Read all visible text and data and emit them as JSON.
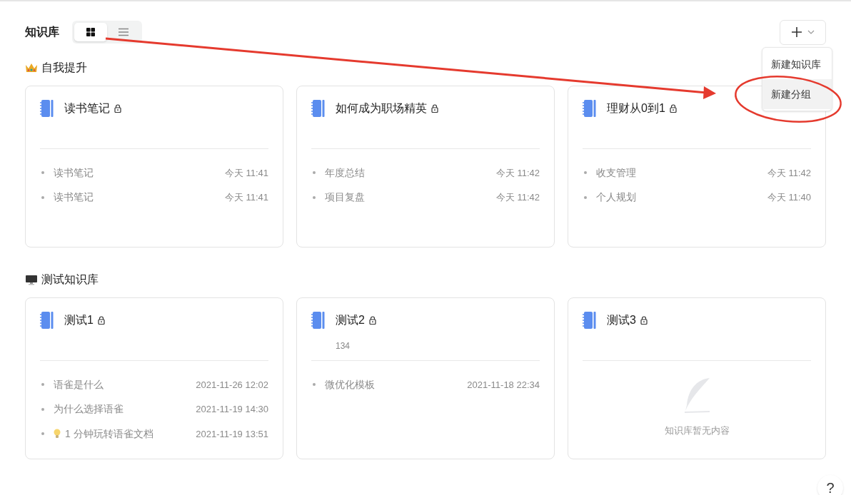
{
  "header": {
    "title": "知识库",
    "view_toggle": [
      {
        "kind": "grid",
        "selected": true
      },
      {
        "kind": "list",
        "selected": false
      }
    ]
  },
  "add_menu": {
    "expanded": true,
    "items": [
      {
        "label": "新建知识库",
        "selected": false
      },
      {
        "label": "新建分组",
        "selected": true
      }
    ]
  },
  "groups": [
    {
      "kind": "crown",
      "title": "自我提升",
      "books": [
        {
          "title": "读书笔记",
          "locked": true,
          "docs": [
            {
              "kind": "doc",
              "title": "读书笔记",
              "time": "今天 11:41"
            },
            {
              "kind": "doc",
              "title": "读书笔记",
              "time": "今天 11:41"
            }
          ]
        },
        {
          "title": "如何成为职场精英",
          "locked": true,
          "docs": [
            {
              "kind": "doc",
              "title": "年度总结",
              "time": "今天 11:42"
            },
            {
              "kind": "doc",
              "title": "项目复盘",
              "time": "今天 11:42"
            }
          ]
        },
        {
          "title": "理财从0到1",
          "locked": true,
          "docs": [
            {
              "kind": "doc",
              "title": "收支管理",
              "time": "今天 11:42"
            },
            {
              "kind": "doc",
              "title": "个人规划",
              "time": "今天 11:40"
            }
          ]
        }
      ]
    },
    {
      "kind": "monitor",
      "title": "测试知识库",
      "books": [
        {
          "title": "测试1",
          "locked": true,
          "docs": [
            {
              "kind": "doc",
              "title": "语雀是什么",
              "time": "2021-11-26 12:02"
            },
            {
              "kind": "doc",
              "title": "为什么选择语雀",
              "time": "2021-11-19 14:30"
            },
            {
              "kind": "tip",
              "title": "1 分钟玩转语雀文档",
              "time": "2021-11-19 13:51"
            }
          ]
        },
        {
          "title": "测试2",
          "locked": true,
          "description": "134",
          "docs": [
            {
              "kind": "doc",
              "title": "微优化模板",
              "time": "2021-11-18 22:34"
            }
          ]
        },
        {
          "title": "测试3",
          "locked": true,
          "empty_text": "知识库暂无内容"
        }
      ]
    }
  ],
  "help_button": {
    "label": "?"
  }
}
